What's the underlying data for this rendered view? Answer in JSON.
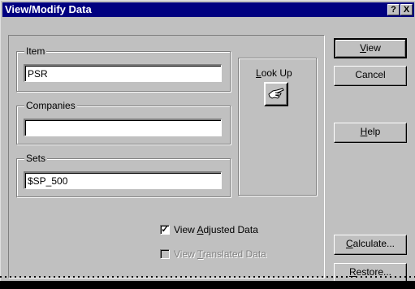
{
  "window": {
    "title": "View/Modify Data",
    "help_glyph": "?",
    "close_glyph": "X"
  },
  "groups": {
    "item": {
      "label": "Item",
      "value": "PSR"
    },
    "companies": {
      "label": "Companies",
      "value": ""
    },
    "sets": {
      "label": "Sets",
      "value": "$SP_500"
    }
  },
  "lookup": {
    "label_prefix": "",
    "label_accel": "L",
    "label_rest": "ook Up",
    "icon": "hand-pointer-icon"
  },
  "buttons": {
    "view": {
      "accel": "V",
      "rest": "iew"
    },
    "cancel": "Cancel",
    "help": {
      "accel": "H",
      "rest": "elp"
    },
    "calculate": {
      "accel": "C",
      "rest": "alculate..."
    },
    "restore": {
      "accel": "R",
      "rest": "estore..."
    }
  },
  "checkboxes": {
    "adjusted": {
      "prefix": "View ",
      "accel": "A",
      "rest": "djusted Data",
      "checked": true,
      "mark": "✓",
      "enabled": true
    },
    "translated": {
      "prefix": "View ",
      "accel": "T",
      "rest": "ranslated Data",
      "checked": false,
      "enabled": false
    }
  },
  "colors": {
    "titlebar": "#000080",
    "face": "#c0c0c0",
    "disabled_text": "#808080"
  }
}
